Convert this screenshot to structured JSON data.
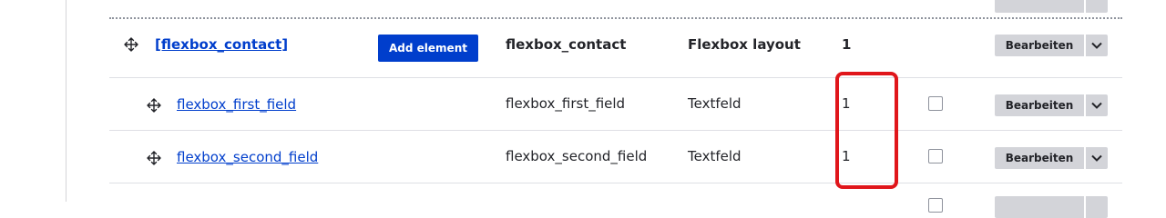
{
  "rows": [
    {
      "title": "[flexbox_contact]",
      "add_element_label": "Add element",
      "key": "flexbox_contact",
      "type": "Flexbox layout",
      "weight": "1",
      "edit_label": "Bearbeiten"
    },
    {
      "title": "flexbox_first_field",
      "key": "flexbox_first_field",
      "type": "Textfeld",
      "weight": "1",
      "required_checked": false,
      "edit_label": "Bearbeiten"
    },
    {
      "title": "flexbox_second_field",
      "key": "flexbox_second_field",
      "type": "Textfeld",
      "weight": "1",
      "required_checked": false,
      "edit_label": "Bearbeiten"
    }
  ],
  "icons": {
    "drag": "drag-handle-icon",
    "dropdown": "chevron-down-icon"
  },
  "colors": {
    "link": "#003ecc",
    "primary_button": "#003ecc",
    "secondary_button": "#d3d4d9",
    "highlight": "#e0161b"
  }
}
